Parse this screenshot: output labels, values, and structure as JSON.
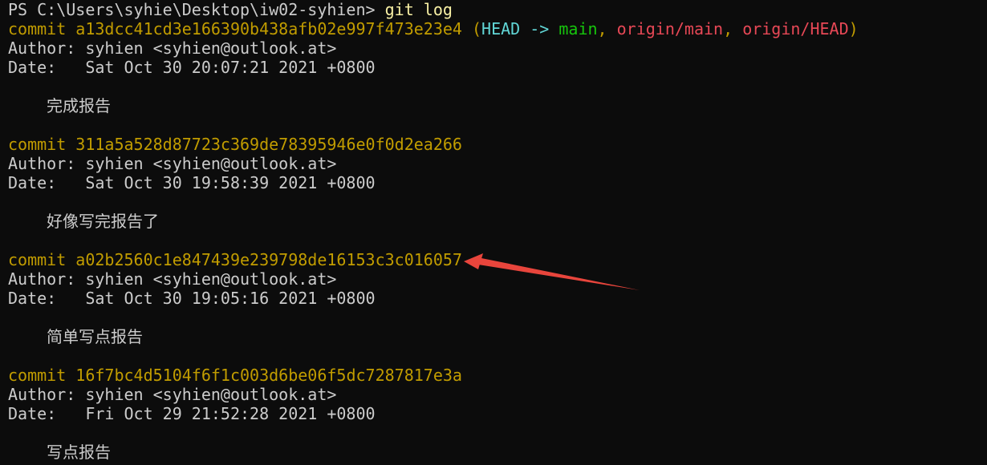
{
  "terminal": {
    "prompt": "PS C:\\Users\\syhie\\Desktop\\iw02-syhien>",
    "command": "git log",
    "refs": {
      "open": "(",
      "head": "HEAD ->",
      "main": "main",
      "sep1": ",",
      "origin_main": "origin/main",
      "sep2": ",",
      "origin_head": "origin/HEAD",
      "close": ")"
    },
    "commits": [
      {
        "label": "commit",
        "hash": "a13dcc41cd3e166390b438afb02e997f473e23e4",
        "author": "Author: syhien <syhien@outlook.at>",
        "date": "Date:   Sat Oct 30 20:07:21 2021 +0800",
        "message": "完成报告"
      },
      {
        "label": "commit",
        "hash": "311a5a528d87723c369de78395946e0f0d2ea266",
        "author": "Author: syhien <syhien@outlook.at>",
        "date": "Date:   Sat Oct 30 19:58:39 2021 +0800",
        "message": "好像写完报告了"
      },
      {
        "label": "commit",
        "hash": "a02b2560c1e847439e239798de16153c3c016057",
        "author": "Author: syhien <syhien@outlook.at>",
        "date": "Date:   Sat Oct 30 19:05:16 2021 +0800",
        "message": "简单写点报告"
      },
      {
        "label": "commit",
        "hash": "16f7bc4d5104f6f1c003d6be06f5dc7287817e3a",
        "author": "Author: syhien <syhien@outlook.at>",
        "date": "Date:   Fri Oct 29 21:52:28 2021 +0800",
        "message": "写点报告"
      }
    ]
  },
  "annotation": {
    "color": "#e8453c",
    "icon": "red-arrow-icon"
  }
}
